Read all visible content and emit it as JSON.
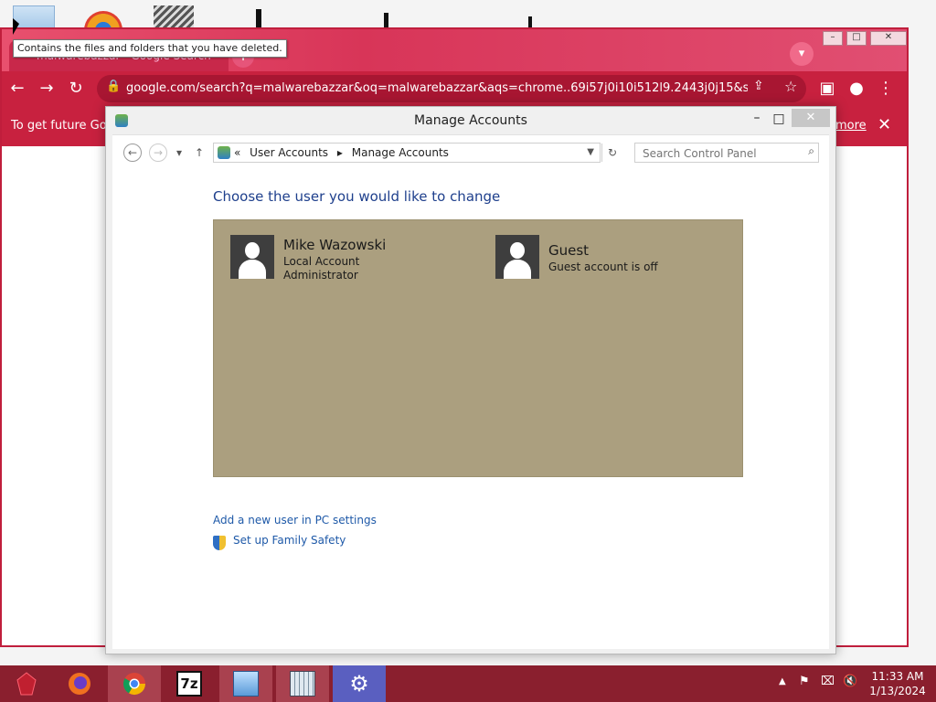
{
  "desktop": {
    "icons": [
      "recycle-bin-icon",
      "browser-icon",
      "copies-icon"
    ]
  },
  "tooltip": {
    "text": "Contains the files and folders that you have deleted."
  },
  "chrome": {
    "tab_title": "malwarebazzar - Google Search",
    "url": "google.com/search?q=malwarebazzar&oq=malwarebazzar&aqs=chrome..69i57j0i10i512l9.2443j0j15&sourc...",
    "infobar_text": "To get future Goo",
    "infobar_link": "more",
    "accent": "#c8213f"
  },
  "control_panel": {
    "window_title": "Manage Accounts",
    "breadcrumb": [
      "User Accounts",
      "Manage Accounts"
    ],
    "breadcrumb_prefix": "«",
    "search_placeholder": "Search Control Panel",
    "heading": "Choose the user you would like to change",
    "accounts": [
      {
        "name": "Mike Wazowski",
        "lines": [
          "Local Account",
          "Administrator"
        ]
      },
      {
        "name": "Guest",
        "lines": [
          "Guest account is off"
        ]
      }
    ],
    "links": {
      "add_user": "Add a new user in PC settings",
      "family_safety": "Set up Family Safety"
    },
    "panel_color": "#ab9f7f"
  },
  "taskbar": {
    "apps": [
      "start-icon",
      "firefox-icon",
      "chrome-icon",
      "7zip-icon",
      "control-panel-icon",
      "keyboard-icon",
      "settings-icon"
    ],
    "seven_zip_label": "7z",
    "clock_time": "11:33 AM",
    "clock_date": "1/13/2024",
    "color": "#8a1f2e"
  }
}
